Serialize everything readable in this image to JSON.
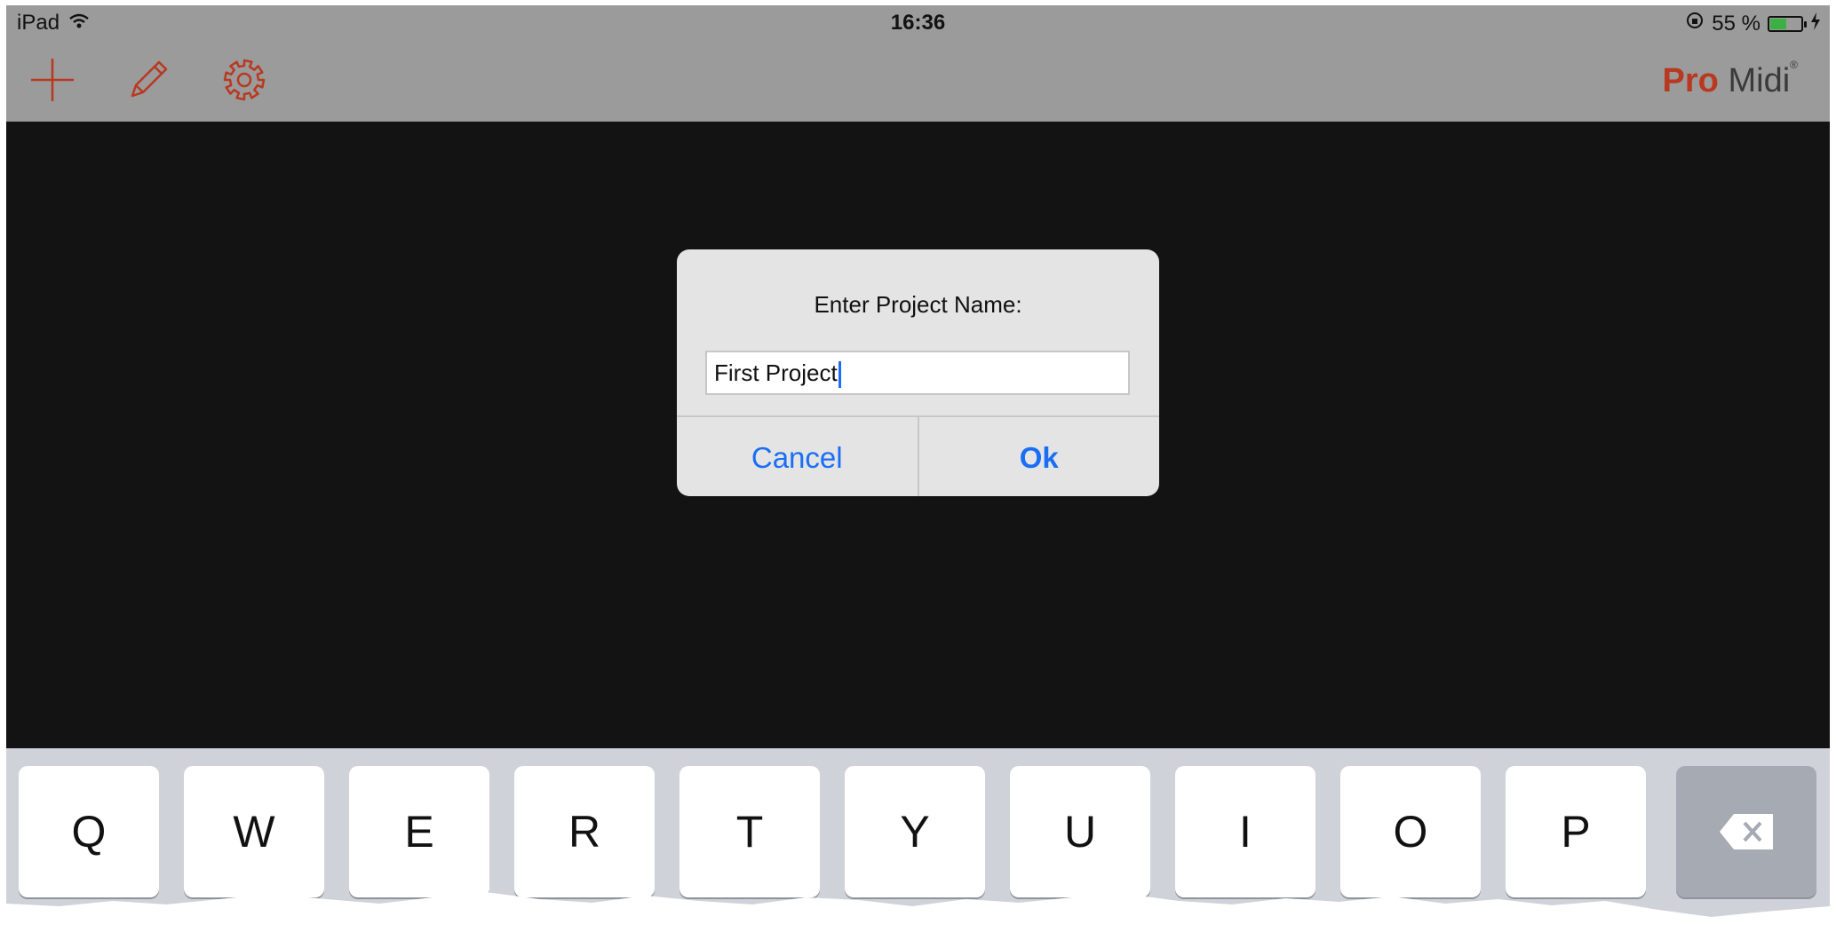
{
  "status_bar": {
    "device": "iPad",
    "time": "16:36",
    "battery": "55 %",
    "battery_level": 0.55,
    "icons": [
      "wifi-icon",
      "orientation-lock-icon",
      "battery-icon",
      "charging-bolt-icon"
    ]
  },
  "toolbar": {
    "brand_bold": "Pro",
    "brand_light": "Midi",
    "brand_mark": "®",
    "icons": [
      "plus-icon",
      "pencil-icon",
      "gear-icon"
    ],
    "accent_color": "#b8391f"
  },
  "dialog": {
    "title": "Enter Project Name:",
    "input_value": "First Project",
    "cancel_label": "Cancel",
    "ok_label": "Ok",
    "button_color": "#1a6ef5"
  },
  "keyboard": {
    "keys": [
      "Q",
      "W",
      "E",
      "R",
      "T",
      "Y",
      "U",
      "I",
      "O",
      "P"
    ],
    "delete_icon": "backspace-icon"
  }
}
